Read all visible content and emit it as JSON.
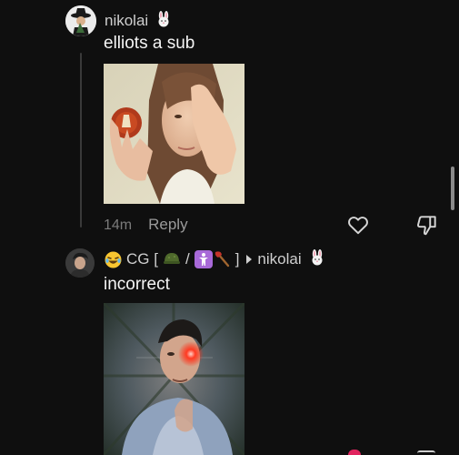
{
  "comments": [
    {
      "username": "nikolai",
      "name_emoji": "rabbit-face",
      "text": "elliots a sub",
      "timestamp": "14m",
      "reply_label": "Reply",
      "image": "photo-woman-holding-red-object"
    },
    {
      "username": "CG [",
      "flair_separator": "/",
      "flair_close": "]",
      "reply_to": "nikolai",
      "reply_to_emoji": "rabbit-face",
      "text": "incorrect",
      "image": "photo-man-glowing-red-eye-zoom-blur"
    }
  ],
  "colors": {
    "background": "#0f0f0f",
    "text_primary": "#f5f5f5",
    "text_secondary": "#cfcfcf",
    "meta": "#7b7b7b",
    "like_active": "#e0245e"
  },
  "icons": [
    "rabbit-emoji",
    "laughing-emoji",
    "helmet-emoji",
    "person-emoji",
    "axe-emoji",
    "heart-icon",
    "thumbs-down-icon",
    "reply-arrow-icon"
  ]
}
